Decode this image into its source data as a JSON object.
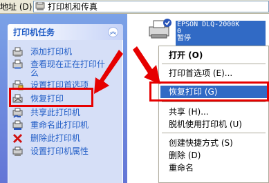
{
  "address_bar": {
    "label": "地址 (D)",
    "path": "打印机和传真"
  },
  "task_pane": {
    "title": "打印机任务",
    "collapse_glyph": "︽",
    "items": [
      {
        "label": "添加打印机",
        "icon": "add-printer-icon"
      },
      {
        "label": "查看现在正在打印什么",
        "label_line1": "查看现在正在打印什",
        "label_line2": "么",
        "icon": "queue-icon"
      },
      {
        "label": "设置打印首选项",
        "icon": "preferences-icon"
      },
      {
        "label": "恢复打印",
        "icon": "resume-printing-icon"
      },
      {
        "label": "共享此打印机",
        "icon": "share-printer-icon"
      },
      {
        "label": "重命名此打印机",
        "icon": "rename-printer-icon"
      },
      {
        "label": "删除此打印机",
        "icon": "delete-x-icon"
      },
      {
        "label": "设置打印机属性",
        "icon": "properties-icon"
      }
    ]
  },
  "printer": {
    "name_line1": "EPSON DLQ-2000K",
    "name_line2": "0",
    "status": "暂停"
  },
  "context_menu": {
    "items": [
      {
        "label": "打开 (O)",
        "bold": true
      },
      {
        "label": "打印首选项 (E)..."
      },
      {
        "label": "恢复打印 (G)",
        "selected": true
      },
      {
        "label": "共享 (H)..."
      },
      {
        "label": "脱机使用打印机 (U)"
      },
      {
        "label": "创建快捷方式 (S)"
      },
      {
        "label": "删除 (D)"
      },
      {
        "label": "重命名"
      }
    ]
  },
  "colors": {
    "highlight_red": "#e60000",
    "task_link_blue": "#215dc6",
    "menu_selection": "#316ac5"
  }
}
